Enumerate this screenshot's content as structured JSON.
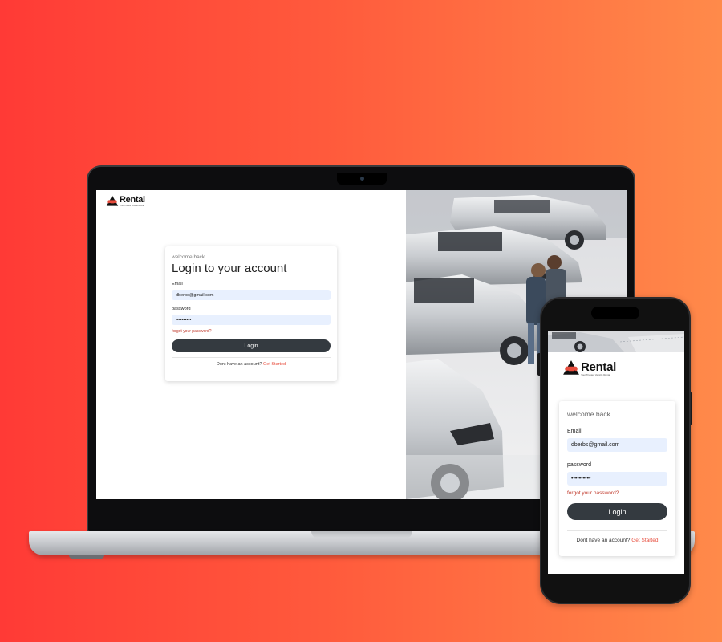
{
  "brand": {
    "name": "Rental",
    "tagline": "Your Trusted Vehicle Rental",
    "accent": "#e74c3c",
    "dark": "#343a40"
  },
  "login": {
    "welcome": "welcome back",
    "title": "Login to your account",
    "email_label": "Email",
    "email_value": "dberbs@gmail.com",
    "password_label": "password",
    "password_value": "••••••••••",
    "forgot_link": "forgot your password?",
    "submit_label": "Login",
    "signup_prompt": "Dont have an account?",
    "signup_link": "Get Started"
  },
  "hero_image": {
    "icon": "car-showroom-photo"
  }
}
